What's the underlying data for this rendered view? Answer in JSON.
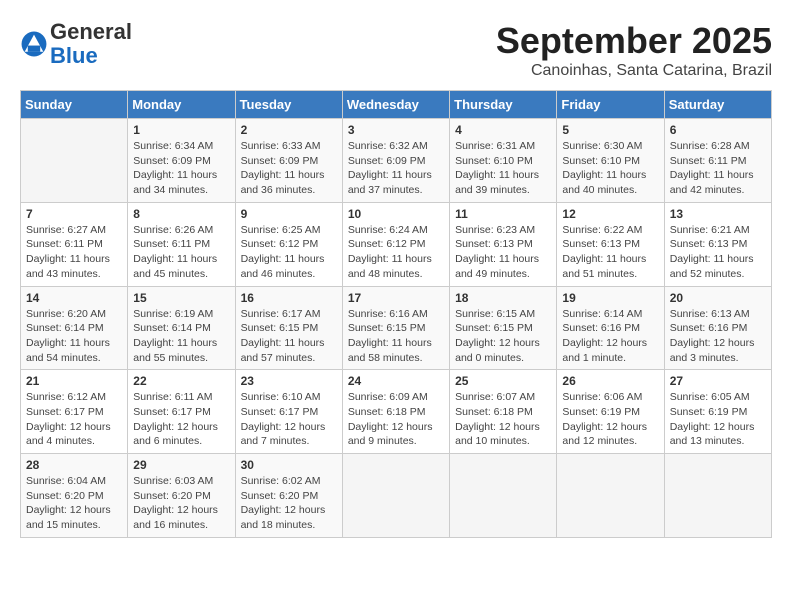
{
  "logo": {
    "general": "General",
    "blue": "Blue"
  },
  "header": {
    "month": "September 2025",
    "location": "Canoinhas, Santa Catarina, Brazil"
  },
  "days_of_week": [
    "Sunday",
    "Monday",
    "Tuesday",
    "Wednesday",
    "Thursday",
    "Friday",
    "Saturday"
  ],
  "weeks": [
    [
      {
        "day": "",
        "info": ""
      },
      {
        "day": "1",
        "info": "Sunrise: 6:34 AM\nSunset: 6:09 PM\nDaylight: 11 hours\nand 34 minutes."
      },
      {
        "day": "2",
        "info": "Sunrise: 6:33 AM\nSunset: 6:09 PM\nDaylight: 11 hours\nand 36 minutes."
      },
      {
        "day": "3",
        "info": "Sunrise: 6:32 AM\nSunset: 6:09 PM\nDaylight: 11 hours\nand 37 minutes."
      },
      {
        "day": "4",
        "info": "Sunrise: 6:31 AM\nSunset: 6:10 PM\nDaylight: 11 hours\nand 39 minutes."
      },
      {
        "day": "5",
        "info": "Sunrise: 6:30 AM\nSunset: 6:10 PM\nDaylight: 11 hours\nand 40 minutes."
      },
      {
        "day": "6",
        "info": "Sunrise: 6:28 AM\nSunset: 6:11 PM\nDaylight: 11 hours\nand 42 minutes."
      }
    ],
    [
      {
        "day": "7",
        "info": "Sunrise: 6:27 AM\nSunset: 6:11 PM\nDaylight: 11 hours\nand 43 minutes."
      },
      {
        "day": "8",
        "info": "Sunrise: 6:26 AM\nSunset: 6:11 PM\nDaylight: 11 hours\nand 45 minutes."
      },
      {
        "day": "9",
        "info": "Sunrise: 6:25 AM\nSunset: 6:12 PM\nDaylight: 11 hours\nand 46 minutes."
      },
      {
        "day": "10",
        "info": "Sunrise: 6:24 AM\nSunset: 6:12 PM\nDaylight: 11 hours\nand 48 minutes."
      },
      {
        "day": "11",
        "info": "Sunrise: 6:23 AM\nSunset: 6:13 PM\nDaylight: 11 hours\nand 49 minutes."
      },
      {
        "day": "12",
        "info": "Sunrise: 6:22 AM\nSunset: 6:13 PM\nDaylight: 11 hours\nand 51 minutes."
      },
      {
        "day": "13",
        "info": "Sunrise: 6:21 AM\nSunset: 6:13 PM\nDaylight: 11 hours\nand 52 minutes."
      }
    ],
    [
      {
        "day": "14",
        "info": "Sunrise: 6:20 AM\nSunset: 6:14 PM\nDaylight: 11 hours\nand 54 minutes."
      },
      {
        "day": "15",
        "info": "Sunrise: 6:19 AM\nSunset: 6:14 PM\nDaylight: 11 hours\nand 55 minutes."
      },
      {
        "day": "16",
        "info": "Sunrise: 6:17 AM\nSunset: 6:15 PM\nDaylight: 11 hours\nand 57 minutes."
      },
      {
        "day": "17",
        "info": "Sunrise: 6:16 AM\nSunset: 6:15 PM\nDaylight: 11 hours\nand 58 minutes."
      },
      {
        "day": "18",
        "info": "Sunrise: 6:15 AM\nSunset: 6:15 PM\nDaylight: 12 hours\nand 0 minutes."
      },
      {
        "day": "19",
        "info": "Sunrise: 6:14 AM\nSunset: 6:16 PM\nDaylight: 12 hours\nand 1 minute."
      },
      {
        "day": "20",
        "info": "Sunrise: 6:13 AM\nSunset: 6:16 PM\nDaylight: 12 hours\nand 3 minutes."
      }
    ],
    [
      {
        "day": "21",
        "info": "Sunrise: 6:12 AM\nSunset: 6:17 PM\nDaylight: 12 hours\nand 4 minutes."
      },
      {
        "day": "22",
        "info": "Sunrise: 6:11 AM\nSunset: 6:17 PM\nDaylight: 12 hours\nand 6 minutes."
      },
      {
        "day": "23",
        "info": "Sunrise: 6:10 AM\nSunset: 6:17 PM\nDaylight: 12 hours\nand 7 minutes."
      },
      {
        "day": "24",
        "info": "Sunrise: 6:09 AM\nSunset: 6:18 PM\nDaylight: 12 hours\nand 9 minutes."
      },
      {
        "day": "25",
        "info": "Sunrise: 6:07 AM\nSunset: 6:18 PM\nDaylight: 12 hours\nand 10 minutes."
      },
      {
        "day": "26",
        "info": "Sunrise: 6:06 AM\nSunset: 6:19 PM\nDaylight: 12 hours\nand 12 minutes."
      },
      {
        "day": "27",
        "info": "Sunrise: 6:05 AM\nSunset: 6:19 PM\nDaylight: 12 hours\nand 13 minutes."
      }
    ],
    [
      {
        "day": "28",
        "info": "Sunrise: 6:04 AM\nSunset: 6:20 PM\nDaylight: 12 hours\nand 15 minutes."
      },
      {
        "day": "29",
        "info": "Sunrise: 6:03 AM\nSunset: 6:20 PM\nDaylight: 12 hours\nand 16 minutes."
      },
      {
        "day": "30",
        "info": "Sunrise: 6:02 AM\nSunset: 6:20 PM\nDaylight: 12 hours\nand 18 minutes."
      },
      {
        "day": "",
        "info": ""
      },
      {
        "day": "",
        "info": ""
      },
      {
        "day": "",
        "info": ""
      },
      {
        "day": "",
        "info": ""
      }
    ]
  ]
}
